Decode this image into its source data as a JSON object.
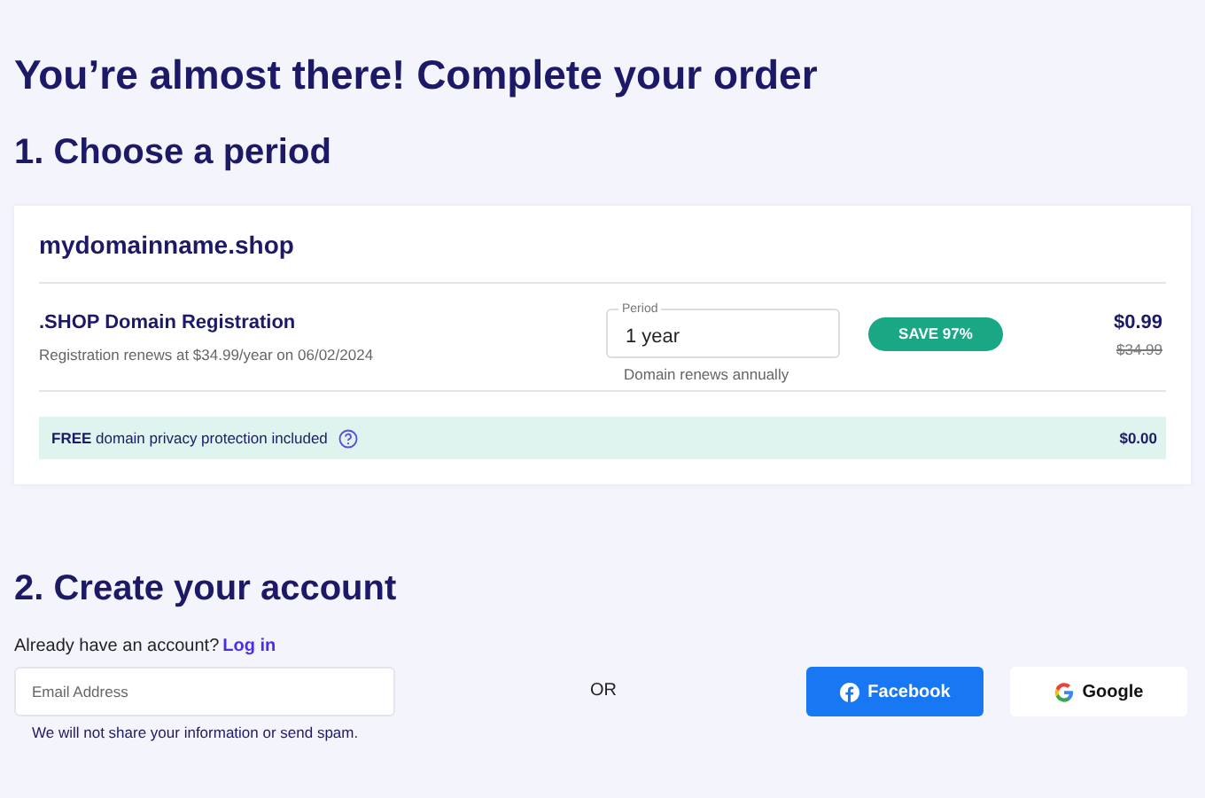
{
  "title": "You’re almost there! Complete your order",
  "period_section": {
    "heading": "1. Choose a period",
    "domain": "mydomainname.shop",
    "product": {
      "name": ".SHOP Domain Registration",
      "renewal": "Registration renews at $34.99/year on 06/02/2024"
    },
    "period_field": {
      "label": "Period",
      "value": "1 year",
      "hint": "Domain renews annually"
    },
    "badge": "SAVE 97%",
    "price": "$0.99",
    "old_price": "$34.99",
    "privacy": {
      "text": "**FREE** domain privacy protection included",
      "price": "$0.00"
    }
  },
  "account_section": {
    "heading": "2. Create your account",
    "login_prompt": "Already have an account?",
    "login_link": "Log in",
    "email": {
      "placeholder": "Email Address"
    },
    "note": "We will not share your information or send spam.",
    "separator": "OR",
    "social_buttons": [
      {
        "kind": "facebook",
        "label": "Facebook"
      },
      {
        "kind": "google",
        "label": "Google"
      }
    ]
  }
}
